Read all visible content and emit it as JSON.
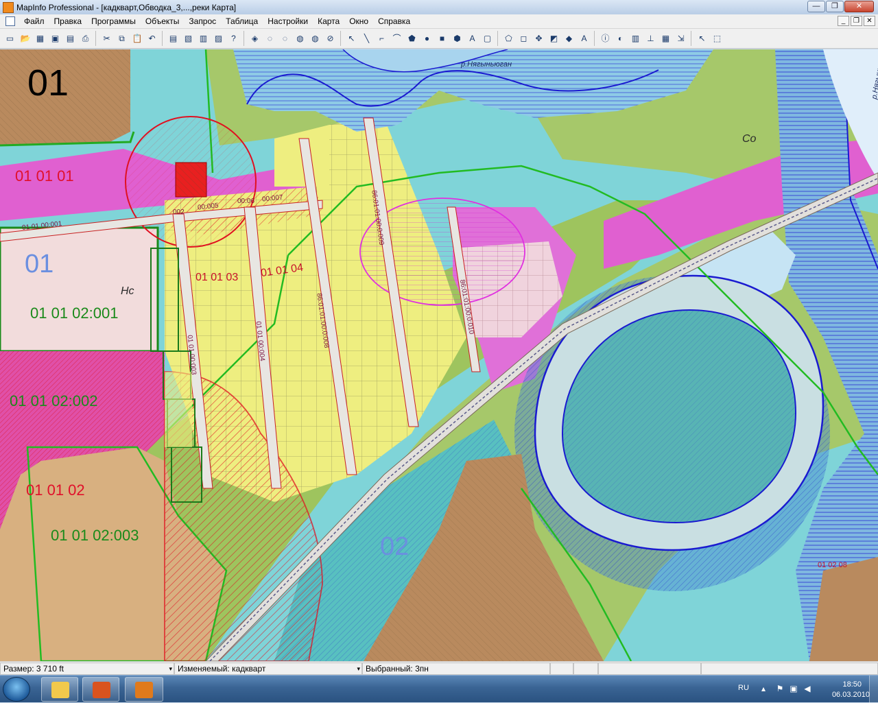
{
  "window": {
    "title": "MapInfo Professional - [кадкварт,Обводка_3,...,реки Карта]",
    "min_glyph": "—",
    "max_glyph": "❐",
    "close_glyph": "✕"
  },
  "menu": {
    "items": [
      "Файл",
      "Правка",
      "Программы",
      "Объекты",
      "Запрос",
      "Таблица",
      "Настройки",
      "Карта",
      "Окно",
      "Справка"
    ],
    "mdi_min": "_",
    "mdi_restore": "❐",
    "mdi_close": "✕"
  },
  "toolbar": {
    "icons": [
      {
        "name": "new-icon",
        "glyph": "▭"
      },
      {
        "name": "open-icon",
        "glyph": "📂"
      },
      {
        "name": "open-table-icon",
        "glyph": "▦"
      },
      {
        "name": "save-icon",
        "glyph": "▣"
      },
      {
        "name": "save-copy-icon",
        "glyph": "▤"
      },
      {
        "name": "print-icon",
        "glyph": "⎙"
      },
      {
        "name": "cut-icon",
        "glyph": "✂"
      },
      {
        "name": "copy-icon",
        "glyph": "⧉"
      },
      {
        "name": "paste-icon",
        "glyph": "📋"
      },
      {
        "name": "undo-icon",
        "glyph": "↶"
      },
      {
        "name": "browser-icon",
        "glyph": "▤"
      },
      {
        "name": "map-window-icon",
        "glyph": "▧"
      },
      {
        "name": "graph-icon",
        "glyph": "▥"
      },
      {
        "name": "layout-icon",
        "glyph": "▨"
      },
      {
        "name": "help-pointer-icon",
        "glyph": "?"
      },
      {
        "name": "layer-control-icon",
        "glyph": "◈"
      },
      {
        "name": "disabled-tool-1-icon",
        "glyph": "◌"
      },
      {
        "name": "disabled-tool-2-icon",
        "glyph": "◌"
      },
      {
        "name": "globe-icon",
        "glyph": "◍"
      },
      {
        "name": "globe-refresh-icon",
        "glyph": "◍"
      },
      {
        "name": "disabled-tool-3-icon",
        "glyph": "⊘"
      },
      {
        "name": "select-arrow-icon",
        "glyph": "↖"
      },
      {
        "name": "line-icon",
        "glyph": "╲"
      },
      {
        "name": "polyline-icon",
        "glyph": "⌐"
      },
      {
        "name": "arc-icon",
        "glyph": "⌒"
      },
      {
        "name": "polygon-icon",
        "glyph": "⬟"
      },
      {
        "name": "ellipse-icon",
        "glyph": "●"
      },
      {
        "name": "rectangle-icon",
        "glyph": "■"
      },
      {
        "name": "rounded-rect-icon",
        "glyph": "⬢"
      },
      {
        "name": "text-tool-icon",
        "glyph": "A"
      },
      {
        "name": "frame-icon",
        "glyph": "▢"
      },
      {
        "name": "reshape-icon",
        "glyph": "⬠"
      },
      {
        "name": "add-node-icon",
        "glyph": "◻"
      },
      {
        "name": "drag-window-icon",
        "glyph": "✥"
      },
      {
        "name": "region-style-icon",
        "glyph": "◩"
      },
      {
        "name": "symbol-style-icon",
        "glyph": "◆"
      },
      {
        "name": "text-style-icon",
        "glyph": "A"
      },
      {
        "name": "info-tool-icon",
        "glyph": "ⓘ"
      },
      {
        "name": "legend-icon",
        "glyph": "◐"
      },
      {
        "name": "statistics-icon",
        "glyph": "▥"
      },
      {
        "name": "ruler-icon",
        "glyph": "⊥"
      },
      {
        "name": "color-palette-icon",
        "glyph": "▦"
      },
      {
        "name": "export-icon",
        "glyph": "⇲"
      },
      {
        "name": "select-icon",
        "glyph": "↖"
      },
      {
        "name": "marquee-select-icon",
        "glyph": "⬚"
      }
    ]
  },
  "map": {
    "labels": {
      "block_01_top": "01",
      "block_01_left": "01",
      "block_02": "02",
      "q_01_01_01": "01 01 01",
      "q_01_01_02_001": "01 01 02:001",
      "q_01_01_02_002": "01 01 02:002",
      "q_01_01_02": "01 01 02",
      "q_01_01_02_003": "01 01 02:003",
      "q_01_01_03": "01 01 03",
      "q_01_01_04": "01 01 04",
      "q_01_02_08": "01 02 08",
      "road_00_001": "01 01 00:001",
      "road_00_005": "00:005",
      "road_00_006": "00:06",
      "road_00_007": "00:007",
      "road_002": "002",
      "road_v1": "01 01 00:003",
      "road_v2": "01 01 00:004",
      "road_v3": "86:01:01:00:0:008",
      "road_v4": "86:01:01:00:0:009",
      "road_v5": "86:01:01:00:0:010",
      "river_1": "р.Нягыньюган",
      "river_2": "р.Нягыньюган",
      "terrain_hc": "Нс",
      "terrain_co": "Co"
    }
  },
  "status": {
    "size": "Размер: 3 710 ft",
    "editable": "Изменяемый: кадкварт",
    "selected": "Выбранный: 3пн",
    "tick": "▾"
  },
  "taskbar": {
    "lang": "RU",
    "time": "18:50",
    "date": "06.03.2010",
    "colors": {
      "explorer": "#f2c94c",
      "powerpoint": "#d9531e",
      "mapinfo": "#e07a1c"
    }
  }
}
